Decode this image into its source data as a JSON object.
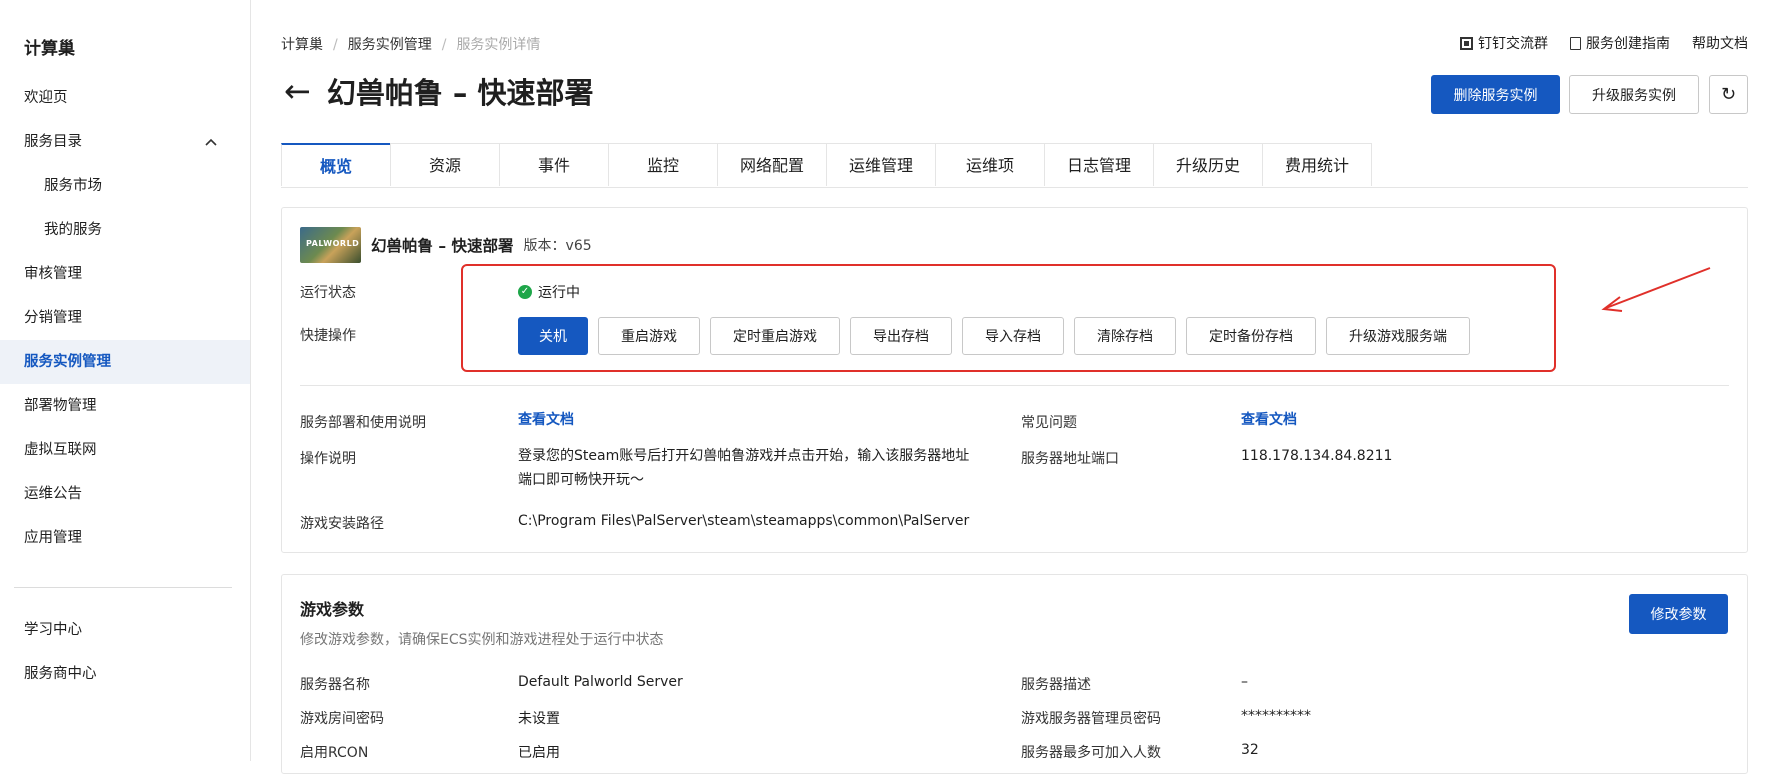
{
  "sidebar": {
    "title": "计算巢",
    "items": [
      {
        "label": "欢迎页"
      },
      {
        "label": "服务目录"
      },
      {
        "label": "服务市场"
      },
      {
        "label": "我的服务"
      },
      {
        "label": "审核管理"
      },
      {
        "label": "分销管理"
      },
      {
        "label": "服务实例管理"
      },
      {
        "label": "部署物管理"
      },
      {
        "label": "虚拟互联网"
      },
      {
        "label": "运维公告"
      },
      {
        "label": "应用管理"
      },
      {
        "label": "学习中心"
      },
      {
        "label": "服务商中心"
      }
    ],
    "chevron": "^"
  },
  "breadcrumb": [
    "计算巢",
    "服务实例管理",
    "服务实例详情"
  ],
  "breadcrumb_sep": "/",
  "top_links": [
    "钉钉交流群",
    "服务创建指南",
    "帮助文档"
  ],
  "page": {
    "title": "幻兽帕鲁 – 快速部署",
    "back_icon": "←",
    "delete_button": "删除服务实例",
    "upgrade_button": "升级服务实例",
    "refresh_icon": "↻"
  },
  "tabs": [
    "概览",
    "资源",
    "事件",
    "监控",
    "网络配置",
    "运维管理",
    "运维项",
    "日志管理",
    "升级历史",
    "费用统计"
  ],
  "overview": {
    "thumb_text": "PALWORLD",
    "app_name": "幻兽帕鲁 – 快速部署",
    "version": "版本：v65",
    "status_label": "运行状态",
    "status_value": "运行中",
    "actions_label": "快捷操作",
    "actions": [
      "关机",
      "重启游戏",
      "定时重启游戏",
      "导出存档",
      "导入存档",
      "清除存档",
      "定时备份存档",
      "升级游戏服务端"
    ],
    "info": {
      "deploy_doc_label": "服务部署和使用说明",
      "deploy_doc_link": "查看文档",
      "faq_label": "常见问题",
      "faq_link": "查看文档",
      "op_label": "操作说明",
      "op_value_line1": "登录您的Steam账号后打开幻兽帕鲁游戏并点击开始，输入该服务器地址",
      "op_value_line2": "端口即可畅快开玩～",
      "addr_label": "服务器地址端口",
      "addr_value": "118.178.134.84.8211",
      "path_label": "游戏安装路径",
      "path_value": "C:\\Program Files\\PalServer\\steam\\steamapps\\common\\PalServer"
    }
  },
  "params": {
    "title": "游戏参数",
    "desc": "修改游戏参数，请确保ECS实例和游戏进程处于运行中状态",
    "edit_button": "修改参数",
    "rows": [
      {
        "l1": "服务器名称",
        "v1": "Default Palworld Server",
        "l2": "服务器描述",
        "v2": "–"
      },
      {
        "l1": "游戏房间密码",
        "v1": "未设置",
        "l2": "游戏服务器管理员密码",
        "v2": "**********"
      },
      {
        "l1": "启用RCON",
        "v1": "已启用",
        "l2": "服务器最多可加入人数",
        "v2": "32"
      }
    ]
  },
  "colors": {
    "accent": "#1558c0",
    "highlight": "#e0302a",
    "success": "#1ea649"
  }
}
